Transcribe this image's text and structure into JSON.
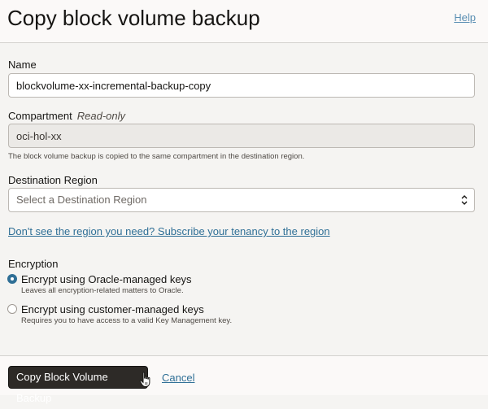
{
  "dialog": {
    "title": "Copy block volume backup",
    "help_label": "Help"
  },
  "form": {
    "name": {
      "label": "Name",
      "value": "blockvolume-xx-incremental-backup-copy"
    },
    "compartment": {
      "label": "Compartment",
      "readonly_label": "Read-only",
      "value": "oci-hol-xx",
      "hint": "The block volume backup is copied to the same compartment in the destination region."
    },
    "destination_region": {
      "label": "Destination Region",
      "placeholder": "Select a Destination Region"
    },
    "subscribe_link": "Don't see the region you need? Subscribe your tenancy to the region",
    "encryption": {
      "label": "Encryption",
      "options": [
        {
          "label": "Encrypt using Oracle-managed keys",
          "hint": "Leaves all encryption-related matters to Oracle.",
          "selected": true
        },
        {
          "label": "Encrypt using customer-managed keys",
          "hint": "Requires you to have access to a valid Key Management key.",
          "selected": false
        }
      ]
    }
  },
  "footer": {
    "primary_label": "Copy Block Volume Backup",
    "cancel_label": "Cancel"
  },
  "colors": {
    "primary_button": "#2d2a27",
    "link": "#2f6f96",
    "radio_selected": "#2f6f96"
  }
}
